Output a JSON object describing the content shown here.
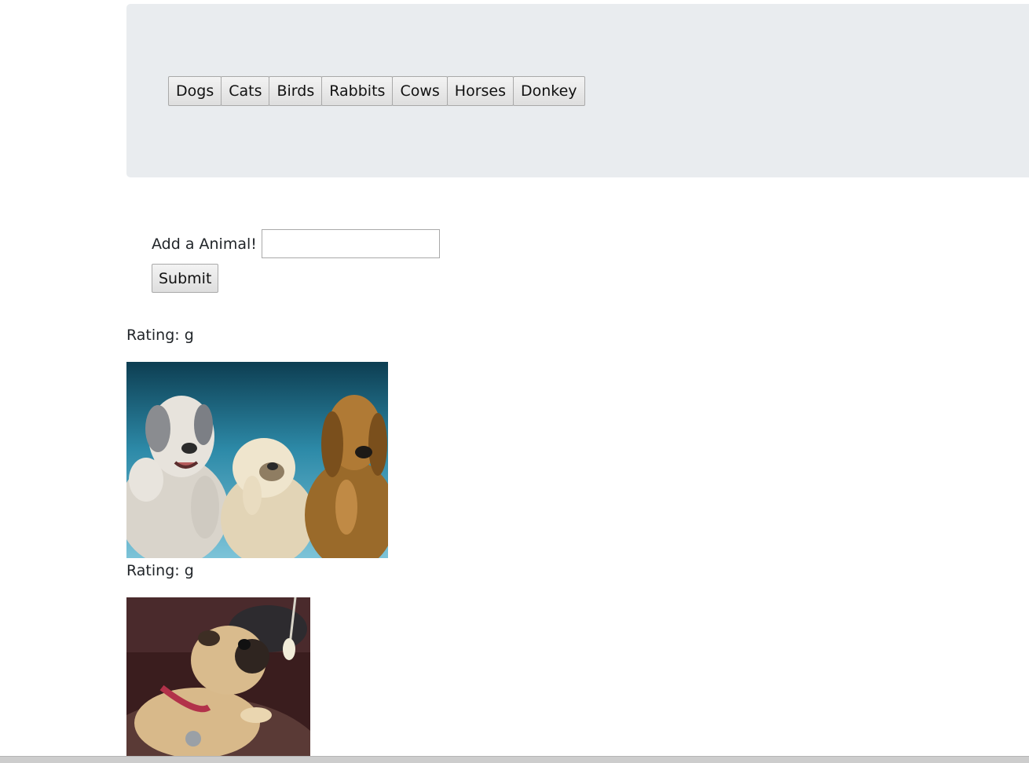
{
  "animals": [
    "Dogs",
    "Cats",
    "Birds",
    "Rabbits",
    "Cows",
    "Horses",
    "Donkey"
  ],
  "form": {
    "label": "Add a Animal!",
    "input_value": "",
    "submit_label": "Submit"
  },
  "gifs": [
    {
      "rating": "Rating: g"
    },
    {
      "rating": "Rating: g"
    }
  ]
}
